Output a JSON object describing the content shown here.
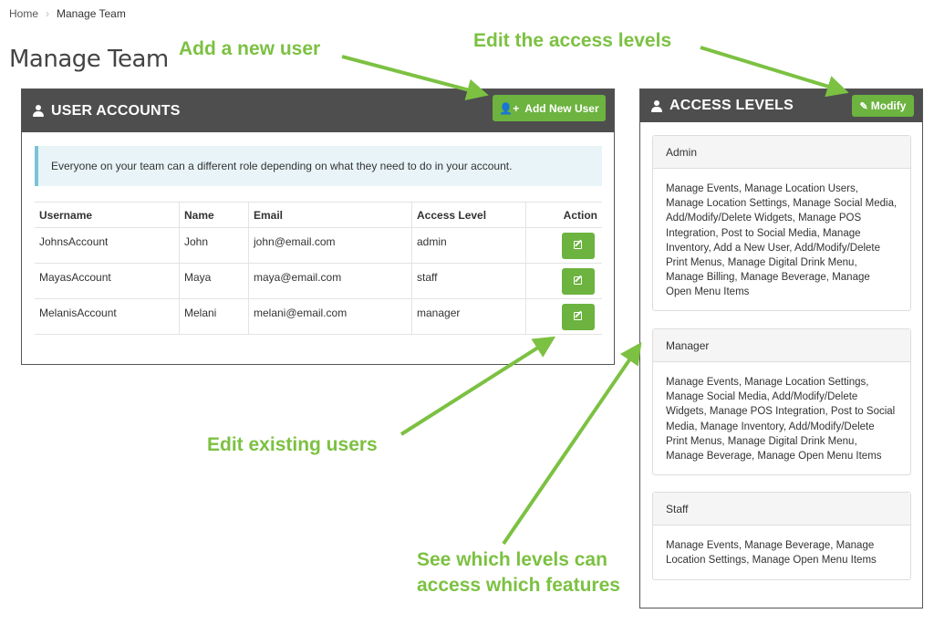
{
  "breadcrumb": {
    "home": "Home",
    "current": "Manage Team"
  },
  "page": {
    "title": "Manage Team"
  },
  "user_accounts": {
    "title": "USER ACCOUNTS",
    "add_button": "Add New User",
    "info": "Everyone on your team can a different role depending on what they need to do in your account.",
    "columns": [
      "Username",
      "Name",
      "Email",
      "Access Level",
      "Action"
    ],
    "rows": [
      {
        "username": "JohnsAccount",
        "name": "John",
        "email": "john@email.com",
        "level": "admin"
      },
      {
        "username": "MayasAccount",
        "name": "Maya",
        "email": "maya@email.com",
        "level": "staff"
      },
      {
        "username": "MelanisAccount",
        "name": "Melani",
        "email": "melani@email.com",
        "level": "manager"
      }
    ]
  },
  "access_levels": {
    "title": "ACCESS LEVELS",
    "modify_button": "Modify",
    "levels": [
      {
        "name": "Admin",
        "features": "Manage Events, Manage Location Users, Manage Location Settings, Manage Social Media, Add/Modify/Delete Widgets, Manage POS Integration, Post to Social Media, Manage Inventory, Add a New User, Add/Modify/Delete Print Menus, Manage Digital Drink Menu, Manage Billing, Manage Beverage, Manage Open Menu Items"
      },
      {
        "name": "Manager",
        "features": "Manage Events, Manage Location Settings, Manage Social Media, Add/Modify/Delete Widgets, Manage POS Integration, Post to Social Media, Manage Inventory, Add/Modify/Delete Print Menus, Manage Digital Drink Menu, Manage Beverage, Manage Open Menu Items"
      },
      {
        "name": "Staff",
        "features": "Manage Events, Manage Beverage, Manage Location Settings, Manage Open Menu Items"
      }
    ]
  },
  "callouts": {
    "add_user": "Add a new user",
    "edit_access": "Edit the access levels",
    "edit_users": "Edit existing users",
    "see_levels_line1": "See which levels can",
    "see_levels_line2": "access which features"
  },
  "colors": {
    "accent_green": "#6cb33f",
    "callout_green": "#7cc142",
    "header_dark": "#4e4e4e",
    "info_bg": "#e8f4f8"
  },
  "icons": {
    "panel_icon": "user-icon",
    "add_icon": "add-user-icon",
    "edit_icon": "edit-icon"
  }
}
